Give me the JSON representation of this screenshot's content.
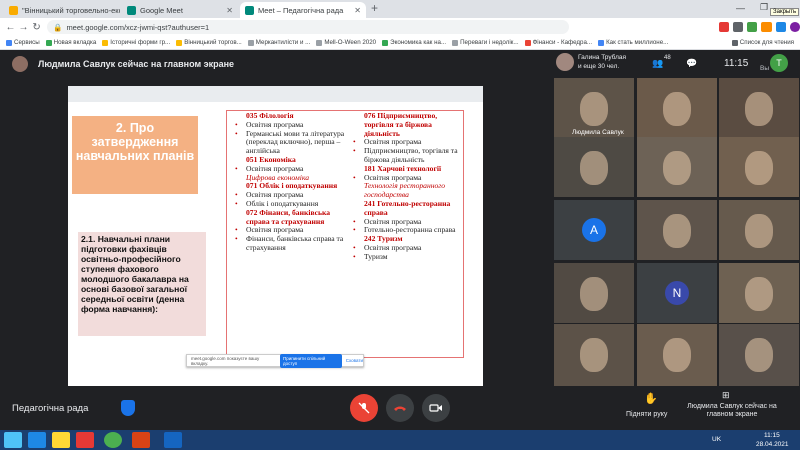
{
  "browser": {
    "tabs": [
      {
        "title": "\"Вінницький торговельно-еко…",
        "active": false
      },
      {
        "title": "Google Meet",
        "active": false
      },
      {
        "title": "Meet – Педагогічна рада",
        "active": true
      }
    ],
    "new_tab": "+",
    "url": "meet.google.com/xcz-jwmi-qst?authuser=1",
    "bookmarks": [
      "Сервисы",
      "Новая вкладка",
      "Історичні форми гр...",
      "Вінницький торгов...",
      "Меркантилісти и ...",
      "Mell-O-Ween 2020",
      "Экономика как на...",
      "Переваги і недолік...",
      "Фінанси - Кафедра...",
      "Как стать миллионе..."
    ],
    "reading_list": "Список для чтения",
    "close_tooltip": "Закрыть"
  },
  "meet": {
    "presenter_banner": "Людмила Савлук сейчас на главном экране",
    "participant_count": "48",
    "time": "11:15",
    "own_label": "Вы",
    "user_avatar_letter": "T",
    "pinned_tile": {
      "name": "Галина Трублая",
      "more": "и еще 30 чел."
    },
    "meeting_name": "Педагогічна рада",
    "raise_hand": "Підняти руку",
    "present_label": "Людмила Савлук сейчас на главном экране",
    "tiles": [
      {
        "label": "Людмила Савлук",
        "letter": ""
      },
      {
        "label": "",
        "letter": ""
      },
      {
        "label": "",
        "letter": ""
      },
      {
        "label": "",
        "letter": ""
      },
      {
        "label": "",
        "letter": ""
      },
      {
        "label": "",
        "letter": ""
      },
      {
        "label": "",
        "letter": "A",
        "color": "#1a73e8"
      },
      {
        "label": "",
        "letter": ""
      },
      {
        "label": "",
        "letter": ""
      },
      {
        "label": "",
        "letter": ""
      },
      {
        "label": "",
        "letter": "N",
        "color": "#3949ab"
      },
      {
        "label": "",
        "letter": ""
      },
      {
        "label": "",
        "letter": ""
      },
      {
        "label": "",
        "letter": ""
      },
      {
        "label": "",
        "letter": ""
      }
    ]
  },
  "slide": {
    "title": "2. Про затвердження навчальних планів",
    "subtitle": "2.1. Навчальні плани підготовки фахівців освітньо-професійного ступеня фахового молодшого бакалавра на основі базової загальної середньої освіти (денна форма навчання):",
    "left_col": [
      {
        "t": "h",
        "v": "035 Філологія"
      },
      {
        "t": "li",
        "v": "Освітня програма"
      },
      {
        "t": "li",
        "v": "Германські мови та література (переклад включно), перша – англійська"
      },
      {
        "t": "h",
        "v": "051 Економіка"
      },
      {
        "t": "li",
        "v": "Освітня програма"
      },
      {
        "t": "it",
        "v": "Цифрова економіка"
      },
      {
        "t": "h",
        "v": "071 Облік і оподаткування"
      },
      {
        "t": "li",
        "v": "Освітня програма"
      },
      {
        "t": "li",
        "v": "Облік і оподаткування"
      },
      {
        "t": "h",
        "v": "072 Фінанси, банківська справа та страхування"
      },
      {
        "t": "li",
        "v": "Освітня програма"
      },
      {
        "t": "li",
        "v": "Фінанси, банківська справа та страхування"
      }
    ],
    "right_col": [
      {
        "t": "h",
        "v": "076 Підприємництво, торгівля та біржова діяльність"
      },
      {
        "t": "li",
        "v": "Освітня програма"
      },
      {
        "t": "li",
        "v": "Підприємництво, торгівля та біржова діяльність"
      },
      {
        "t": "h",
        "v": "181 Харчові технології"
      },
      {
        "t": "li",
        "v": "Освітня програма"
      },
      {
        "t": "it",
        "v": "Технологія ресторанного господарства"
      },
      {
        "t": "h",
        "v": "241 Готельно-ресторанна справа"
      },
      {
        "t": "li",
        "v": "Освітня програма"
      },
      {
        "t": "li",
        "v": "Готельно-ресторанна справа"
      },
      {
        "t": "h",
        "v": "242 Туризм"
      },
      {
        "t": "li",
        "v": "Освітня програма"
      },
      {
        "t": "li",
        "v": "Туризм"
      }
    ],
    "toast": {
      "text": "meet.google.com показуєте вашу вкладку.",
      "button": "Припинити спільний доступ",
      "link": "Сховати"
    }
  },
  "taskbar": {
    "lang": "UK",
    "time": "11:15",
    "date": "28.04.2021"
  }
}
